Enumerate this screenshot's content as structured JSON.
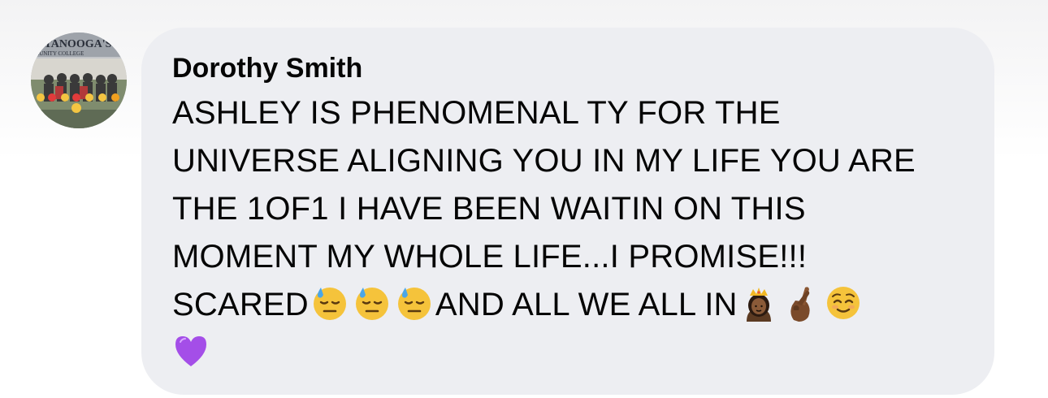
{
  "avatar": {
    "banner_text": "ATTANOOGA'S",
    "banner_subtext": "MUNITY COLLEGE"
  },
  "comment": {
    "author": "Dorothy Smith",
    "lines": [
      "ASHLEY IS PHENOMENAL TY FOR THE",
      "UNIVERSE ALIGNING YOU IN MY LIFE YOU ARE",
      "THE 1OF1 I HAVE BEEN WAITIN ON THIS",
      "MOMENT MY WHOLE LIFE...I PROMISE!!!"
    ],
    "line5_prefix": "SCARED",
    "line5_middle": "AND ALL WE ALL IN"
  },
  "emojis": [
    "downcast-face-with-sweat-icon",
    "downcast-face-with-sweat-icon",
    "downcast-face-with-sweat-icon",
    "princess-icon",
    "crossed-fingers-icon",
    "relieved-face-icon",
    "purple-heart-icon"
  ],
  "colors": {
    "bubble": "#edeef2",
    "text": "#050505"
  }
}
